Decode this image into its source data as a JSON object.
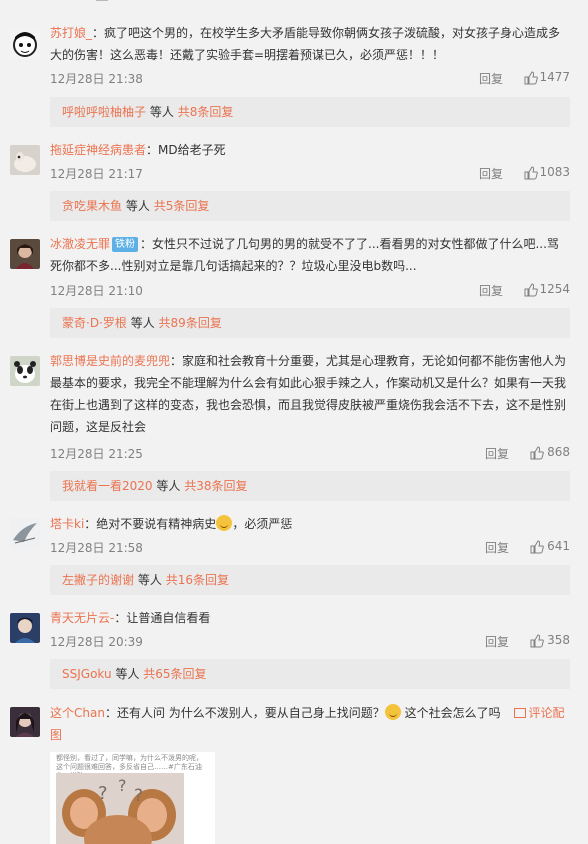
{
  "reply_label": "回复",
  "others_text": "等人",
  "comments": [
    {
      "user": "苏打娘_",
      "text_lines": [
        "：疯了吧这个男的，在校学生多大矛盾能导致你朝俩女孩子泼硫酸，对女孩子身心造成多",
        "大的伤害！这么恶毒！还戴了实验手套=明摆着预谋已久，必须严惩！！！"
      ],
      "time": "12月28日 21:38",
      "likes": "1477",
      "sub_user": "呼啦呼啦柚柚子",
      "sub_count": "共8条回复"
    },
    {
      "user": "拖延症神经病患者",
      "text_lines": [
        "：MD给老子死"
      ],
      "time": "12月28日 21:17",
      "likes": "1083",
      "sub_user": "贪吃果木鱼",
      "sub_count": "共5条回复"
    },
    {
      "user": "冰澈凌无罪",
      "badge": "铁粉",
      "text_lines": [
        "：女性只不过说了几句男的男的就受不了了...看看男的对女性都做了什么吧...骂",
        "死你都不多...性别对立是靠几句话搞起来的？？垃圾心里没电b数吗..."
      ],
      "time": "12月28日 21:10",
      "likes": "1254",
      "sub_user": "蒙奇·D·罗根",
      "sub_count": "共89条回复"
    },
    {
      "user": "郭思博是史前的麦兜兜",
      "text_lines": [
        "：家庭和社会教育十分重要，尤其是心理教育，无论如何都不能伤害他人为",
        "最基本的要求，我完全不能理解为什么会有如此心狠手辣之人，作案动机又是什么？如果有一天我",
        "在街上也遇到了这样的变态，我也会恐惧，而且我觉得皮肤被严重烧伤我会活不下去，这不是性别",
        "问题，这是反社会"
      ],
      "time": "12月28日 21:25",
      "likes": "868",
      "sub_user": "我就看一看2020",
      "sub_count": "共38条回复"
    },
    {
      "user": "塔卡ki",
      "text_lines": [
        "：绝对不要说有精神病史",
        "，必须严惩"
      ],
      "time": "12月28日 21:58",
      "likes": "641",
      "sub_user": "左撇子的谢谢",
      "sub_count": "共16条回复"
    },
    {
      "user": "青天无片云-",
      "text_lines": [
        "：让普通自信看看"
      ],
      "time": "12月28日 20:39",
      "likes": "358",
      "sub_user": "SSJGoku",
      "sub_count": "共65条回复"
    },
    {
      "user": "这个Chan",
      "text_lines": [
        "：还有人问 为什么不泼别人，要从自己身上找问题？",
        "这个社会怎么了吗"
      ],
      "comment_pic_label": "评论配",
      "comment_pic_label2": "图",
      "image_caption": "都怪别，看过了，同学嘛，为什么不泼男的呢，这个问题很难回答，多反省自己……#广东石油化工学院#"
    }
  ],
  "colors": {
    "username": "#eb7350",
    "meta": "#808080",
    "sub_bg": "#eaeaea",
    "page_bg": "#f2f2f2"
  }
}
